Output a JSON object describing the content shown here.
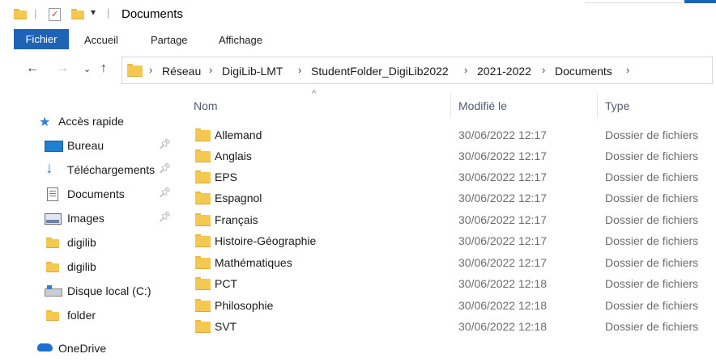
{
  "window": {
    "title": "Documents"
  },
  "ribbon": {
    "tabs": [
      "Fichier",
      "Accueil",
      "Partage",
      "Affichage"
    ]
  },
  "address": {
    "crumbs": [
      "Réseau",
      "DigiLib-LMT",
      "StudentFolder_DigiLib2022",
      "2021-2022",
      "Documents"
    ]
  },
  "sidebar": {
    "quick_access": "Accès rapide",
    "items": [
      {
        "label": "Bureau",
        "icon": "desktop-icon",
        "pinned": true
      },
      {
        "label": "Téléchargements",
        "icon": "download-arrow-icon",
        "pinned": true
      },
      {
        "label": "Documents",
        "icon": "document-icon",
        "pinned": true
      },
      {
        "label": "Images",
        "icon": "image-icon",
        "pinned": true
      },
      {
        "label": "digilib",
        "icon": "folder-icon",
        "pinned": false
      },
      {
        "label": "digilib",
        "icon": "folder-icon",
        "pinned": false
      },
      {
        "label": "Disque local (C:)",
        "icon": "drive-icon",
        "pinned": false
      },
      {
        "label": "folder",
        "icon": "folder-icon",
        "pinned": false
      }
    ],
    "onedrive": "OneDrive"
  },
  "list": {
    "columns": {
      "name": "Nom",
      "modified": "Modifié le",
      "type": "Type"
    },
    "rows": [
      {
        "name": "Allemand",
        "modified": "30/06/2022 12:17",
        "type": "Dossier de fichiers"
      },
      {
        "name": "Anglais",
        "modified": "30/06/2022 12:17",
        "type": "Dossier de fichiers"
      },
      {
        "name": "EPS",
        "modified": "30/06/2022 12:17",
        "type": "Dossier de fichiers"
      },
      {
        "name": "Espagnol",
        "modified": "30/06/2022 12:17",
        "type": "Dossier de fichiers"
      },
      {
        "name": "Français",
        "modified": "30/06/2022 12:17",
        "type": "Dossier de fichiers"
      },
      {
        "name": "Histoire-Géographie",
        "modified": "30/06/2022 12:17",
        "type": "Dossier de fichiers"
      },
      {
        "name": "Mathématiques",
        "modified": "30/06/2022 12:17",
        "type": "Dossier de fichiers"
      },
      {
        "name": "PCT",
        "modified": "30/06/2022 12:18",
        "type": "Dossier de fichiers"
      },
      {
        "name": "Philosophie",
        "modified": "30/06/2022 12:18",
        "type": "Dossier de fichiers"
      },
      {
        "name": "SVT",
        "modified": "30/06/2022 12:18",
        "type": "Dossier de fichiers"
      }
    ]
  },
  "colors": {
    "accent": "#1e63b6",
    "folder": "#f5c851"
  }
}
